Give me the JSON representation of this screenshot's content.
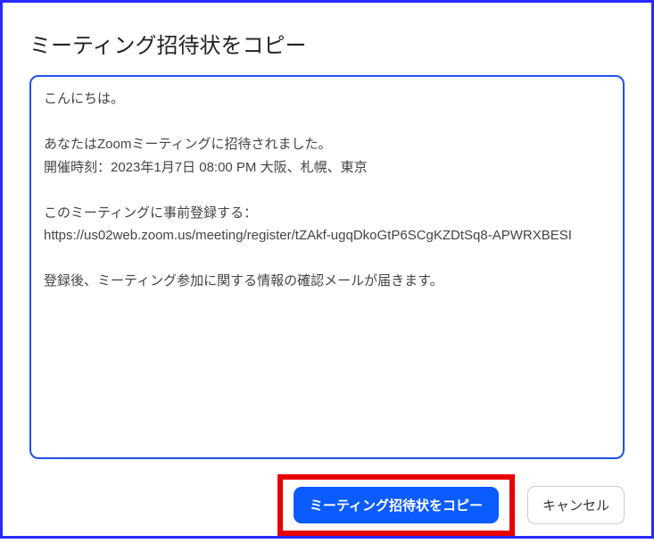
{
  "modal": {
    "title": "ミーティング招待状をコピー",
    "invite_text": "こんにちは。\n\nあなたはZoomミーティングに招待されました。\n開催時刻：2023年1月7日 08:00 PM 大阪、札幌、東京\n\nこのミーティングに事前登録する：\nhttps://us02web.zoom.us/meeting/register/tZAkf-ugqDkoGtP6SCgKZDtSq8-APWRXBESI\n\n登録後、ミーティング参加に関する情報の確認メールが届きます。"
  },
  "buttons": {
    "copy_label": "ミーティング招待状をコピー",
    "cancel_label": "キャンセル"
  }
}
